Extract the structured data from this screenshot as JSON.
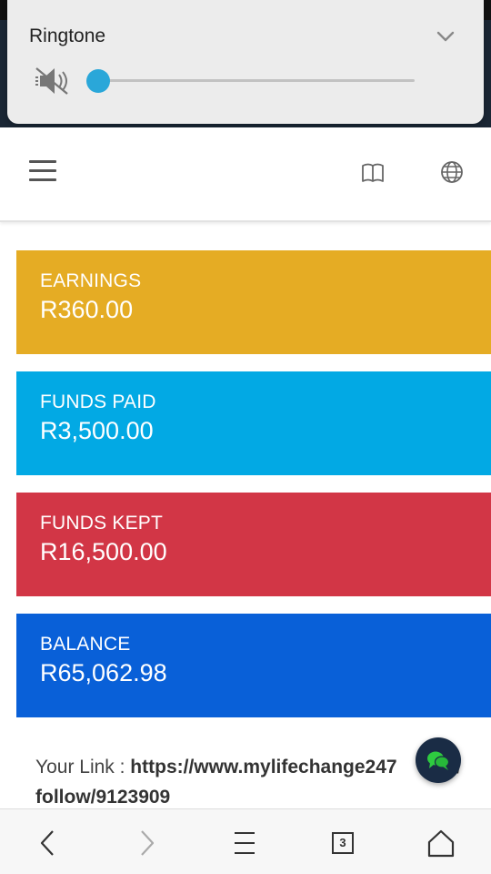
{
  "volume_panel": {
    "title": "Ringtone",
    "level": 0.0,
    "icons": {
      "mute": "volume-mute-icon",
      "expand": "chevron-down-icon"
    },
    "accent_color": "#2aa7d9"
  },
  "header": {
    "icons": [
      "menu-icon",
      "book-icon",
      "globe-icon"
    ]
  },
  "cards": {
    "earnings": {
      "label": "EARNINGS",
      "value": "R360.00",
      "color": "#e5ac24"
    },
    "funds_paid": {
      "label": "FUNDS PAID",
      "value": "R3,500.00",
      "color": "#02a9e4"
    },
    "funds_kept": {
      "label": "FUNDS KEPT",
      "value": "R16,500.00",
      "color": "#d23646"
    },
    "balance": {
      "label": "BALANCE",
      "value": "R65,062.98",
      "color": "#0960d8"
    }
  },
  "link": {
    "prefix": "Your Link : ",
    "url_part1": "https://www.mylifechange247",
    "url_hidden": "n/",
    "url_part2": "follow/9123909"
  },
  "browser_bar": {
    "tab_count": "3",
    "icons": [
      "back-icon",
      "forward-icon",
      "menu-icon",
      "tabs-icon",
      "home-icon"
    ]
  }
}
